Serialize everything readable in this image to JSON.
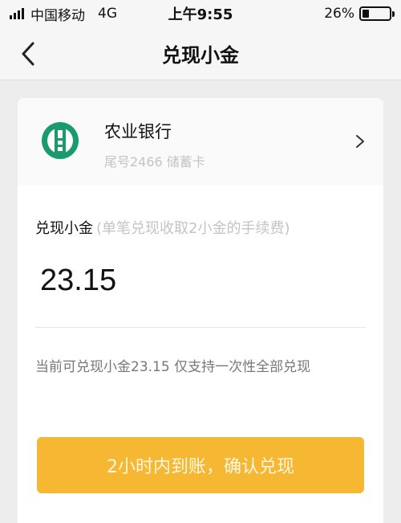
{
  "status_bar": {
    "carrier": "中国移动",
    "network": "4G",
    "time": "上午9:55",
    "battery_percent": "26%",
    "battery_level": 0.26
  },
  "nav": {
    "title": "兑现小金",
    "back_icon": "chevron-left-icon"
  },
  "bank": {
    "name": "农业银行",
    "card_info": "尾号2466 储蓄卡",
    "logo_icon": "agricultural-bank-logo",
    "logo_color": "#1b9a6e",
    "chevron_icon": "chevron-right-icon"
  },
  "redeem": {
    "label": "兑现小金",
    "hint": "(单笔兑现收取2小金的手续费)",
    "amount": "23.15",
    "info": "当前可兑现小金23.15 仅支持一次性全部兑现"
  },
  "confirm": {
    "label": "2小时内到账，确认兑现",
    "color": "#f6b733"
  }
}
